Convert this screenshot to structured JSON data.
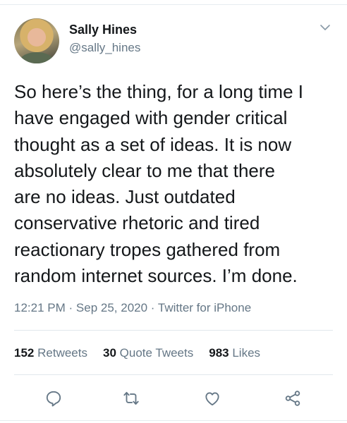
{
  "author": {
    "name": "Sally Hines",
    "handle": "@sally_hines"
  },
  "tweet": {
    "text": "So here’s the thing, for a long time I\nhave engaged with gender critical\nthought as a set of ideas. It is now\nabsolutely clear to me that there\nare no ideas. Just outdated\nconservative rhetoric and tired\nreactionary tropes gathered from\nrandom internet sources. I’m done.",
    "time": "12:21 PM",
    "date": "Sep 25, 2020",
    "source": "Twitter for iPhone",
    "separator": "·"
  },
  "stats": {
    "retweets_count": "152",
    "retweets_label": "Retweets",
    "quotes_count": "30",
    "quotes_label": "Quote Tweets",
    "likes_count": "983",
    "likes_label": "Likes"
  },
  "icons": {
    "menu": "chevron-down-icon",
    "reply": "reply-icon",
    "retweet": "retweet-icon",
    "like": "heart-icon",
    "share": "share-icon"
  },
  "colors": {
    "text": "#14171a",
    "secondary": "#657786",
    "divider": "#e1e8ed",
    "icon": "#657786"
  }
}
